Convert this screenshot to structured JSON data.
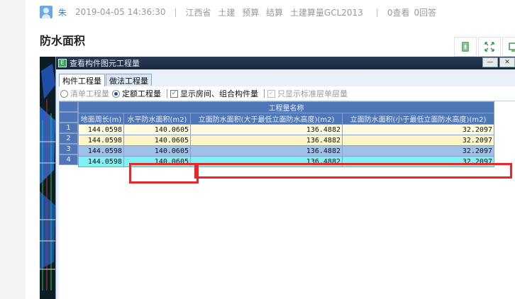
{
  "post": {
    "user": "朱",
    "datetime": "2019-04-05 14:36:30",
    "tags": [
      "江西省",
      "土建",
      "预算",
      "结算",
      "土建算量GCL2013"
    ],
    "views": "0查看",
    "replies": "0回答",
    "title": "防水面积"
  },
  "tools": [
    "restore-icon",
    "expand-icon",
    "fullscreen-icon"
  ],
  "window": {
    "title": "查看构件图元工程量",
    "tabs": [
      "构件工程量",
      "做法工程量"
    ],
    "options": {
      "list_qty": "清单工程量",
      "quota_qty": "定额工程量",
      "show_rooms": "显示房间、组合构件量",
      "std_floor_only": "只显示标准层单层量"
    }
  },
  "table": {
    "group_header": "工程量名称",
    "columns": [
      "地面周长(m)",
      "水平防水面积(m2)",
      "立面防水面积(大于最低立面防水高度)(m2)",
      "立面防水面积(小于最低立面防水高度)(m2)"
    ],
    "rows": [
      {
        "n": "1",
        "cells": [
          "144.0598",
          "140.0605",
          "136.4882",
          "32.2097"
        ]
      },
      {
        "n": "2",
        "cells": [
          "144.0598",
          "140.0605",
          "136.4882",
          "32.2097"
        ]
      },
      {
        "n": "3",
        "cells": [
          "144.0598",
          "140.0605",
          "136.4882",
          "32.2097"
        ]
      },
      {
        "n": "4",
        "cells": [
          "144.0598",
          "140.0605",
          "136.4882",
          "32.2097"
        ]
      }
    ]
  },
  "colors": {
    "header": "#4f77b8",
    "highlight": "#e8272a",
    "selected_row": "#7ff3f3"
  }
}
